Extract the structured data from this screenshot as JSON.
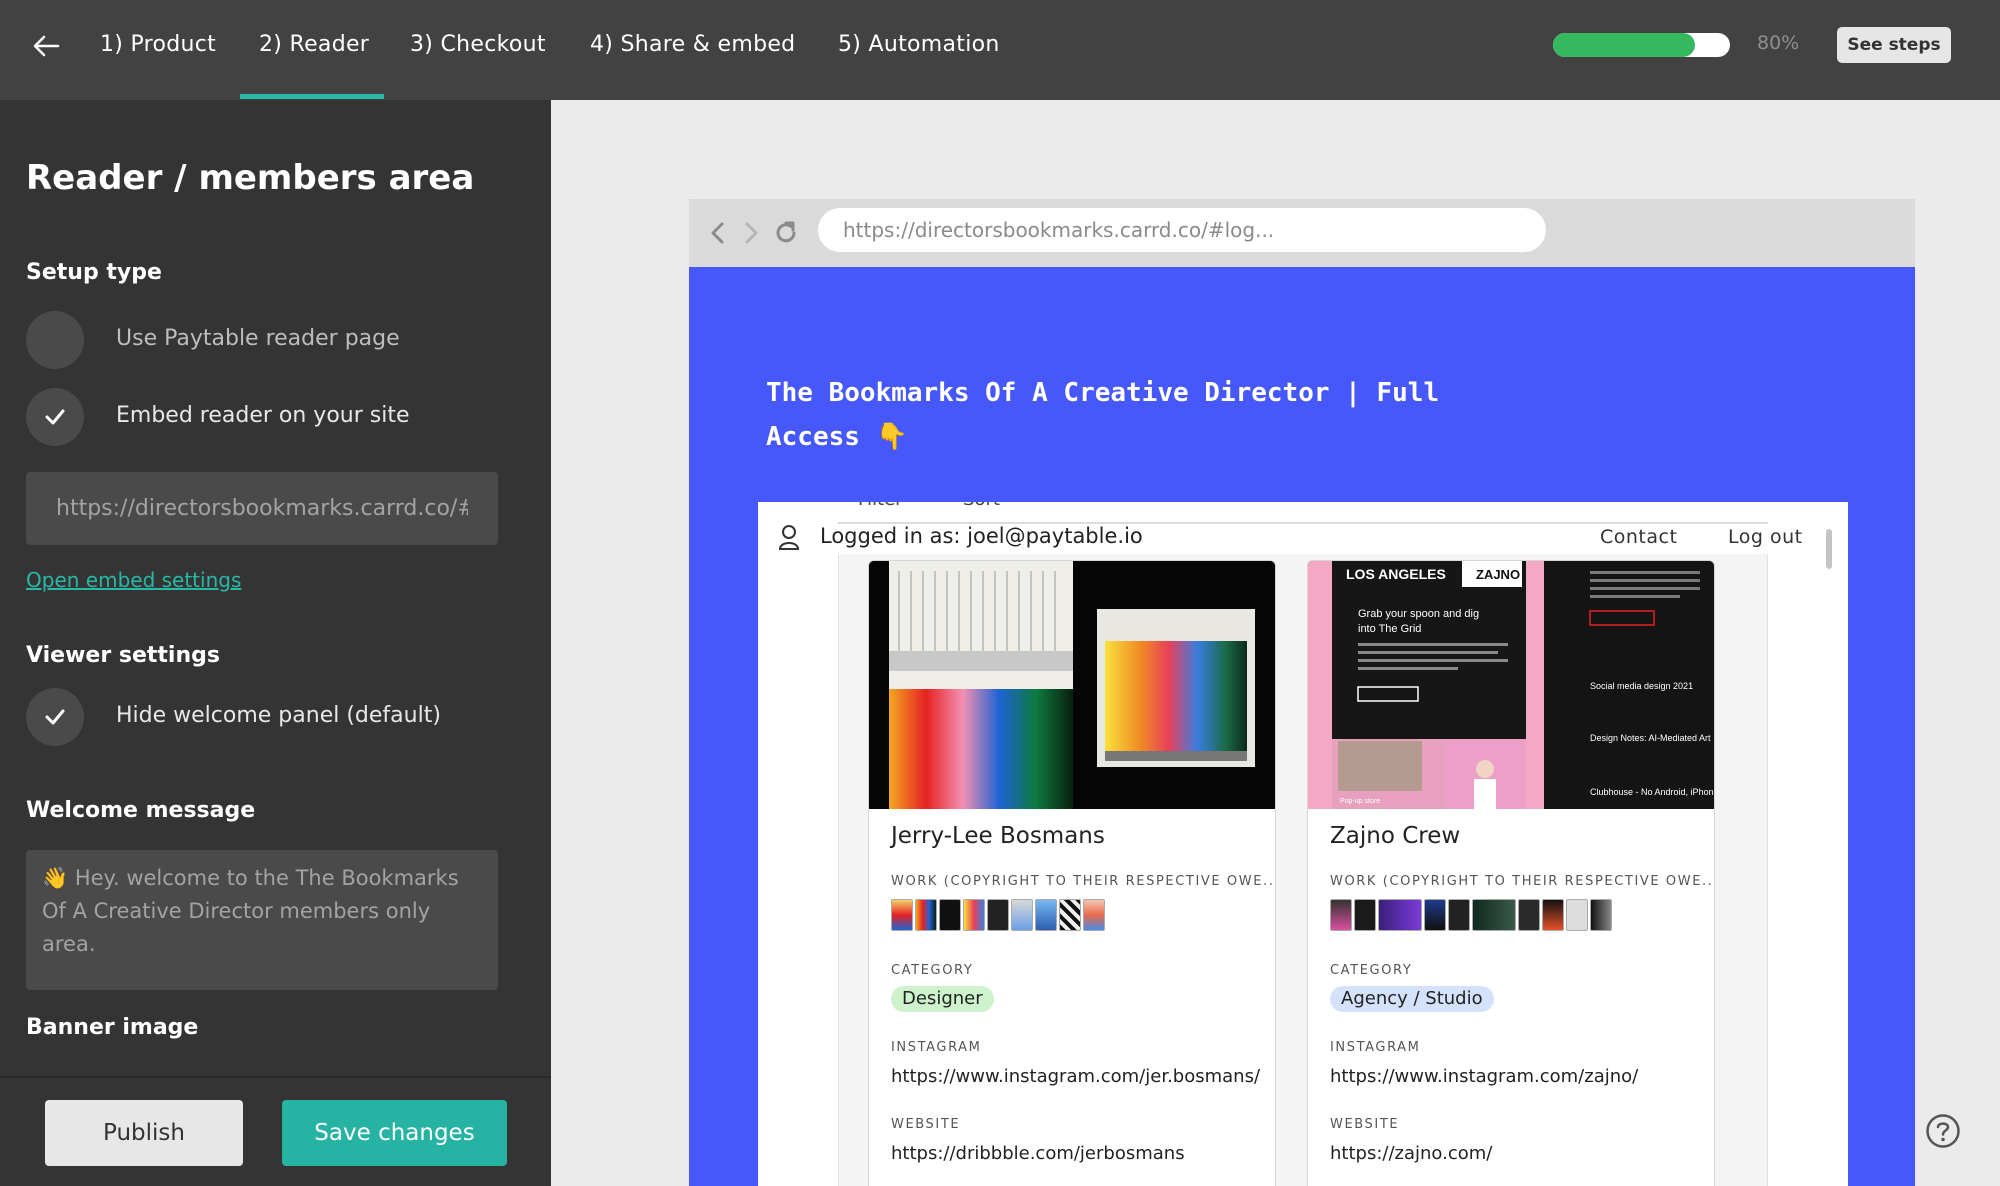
{
  "topbar": {
    "tabs": [
      "1) Product",
      "2) Reader",
      "3) Checkout",
      "4) Share & embed",
      "5) Automation"
    ],
    "active_tab": "2) Reader",
    "progress_percent": 80,
    "progress_label": "80%",
    "see_steps": "See steps",
    "colors": {
      "accent": "#27b8a8",
      "progress": "#36b85f"
    }
  },
  "sidebar": {
    "title": "Reader / members area",
    "setup_type": {
      "heading": "Setup type",
      "options": [
        {
          "label": "Use Paytable reader page",
          "selected": false
        },
        {
          "label": "Embed reader on your site",
          "selected": true
        }
      ],
      "url_value": "https://directorsbookmarks.carrd.co/#log",
      "embed_settings_link": "Open embed settings"
    },
    "viewer_settings": {
      "heading": "Viewer settings",
      "option": "Hide welcome panel (default)",
      "checked": true
    },
    "welcome_message": {
      "heading": "Welcome message",
      "value": "👋 Hey. welcome to the The Bookmarks Of A Creative Director members only area."
    },
    "banner_image_heading": "Banner image",
    "publish_label": "Publish",
    "save_label": "Save changes"
  },
  "preview": {
    "address": "https://directorsbookmarks.carrd.co/#log...",
    "page_title": "The Bookmarks Of A Creative Director |  Full Access 👇",
    "page_color": "#4758fa",
    "clipped_controls": [
      "Filter",
      "Sort"
    ],
    "logged_in": "Logged in as: joel@paytable.io",
    "contact": "Contact",
    "logout": "Log out",
    "cards": [
      {
        "name": "Jerry-Lee Bosmans",
        "work_label": "WORK (COPYRIGHT TO THEIR RESPECTIVE OWE...",
        "category_label": "CATEGORY",
        "category": "Designer",
        "category_color": "#cdf2cc",
        "instagram_label": "INSTAGRAM",
        "instagram": "https://www.instagram.com/jer.bosmans/",
        "website_label": "WEBSITE",
        "website": "https://dribbble.com/jerbosmans"
      },
      {
        "name": "Zajno Crew",
        "work_label": "WORK (COPYRIGHT TO THEIR RESPECTIVE OWE...",
        "category_label": "CATEGORY",
        "category": "Agency / Studio",
        "category_color": "#d4e2fb",
        "instagram_label": "INSTAGRAM",
        "instagram": "https://www.instagram.com/zajno/",
        "website_label": "WEBSITE",
        "website": "https://zajno.com/",
        "image_text": {
          "city": "LOS ANGELES",
          "brand": "ZAJNO",
          "headline": "Grab your spoon and dig into The Grid",
          "popup": "Pop-up store",
          "items": [
            "Social media design 2021",
            "Design Notes: AI-Mediated Art",
            "Clubhouse - No Android, iPhone Only"
          ]
        }
      }
    ]
  }
}
